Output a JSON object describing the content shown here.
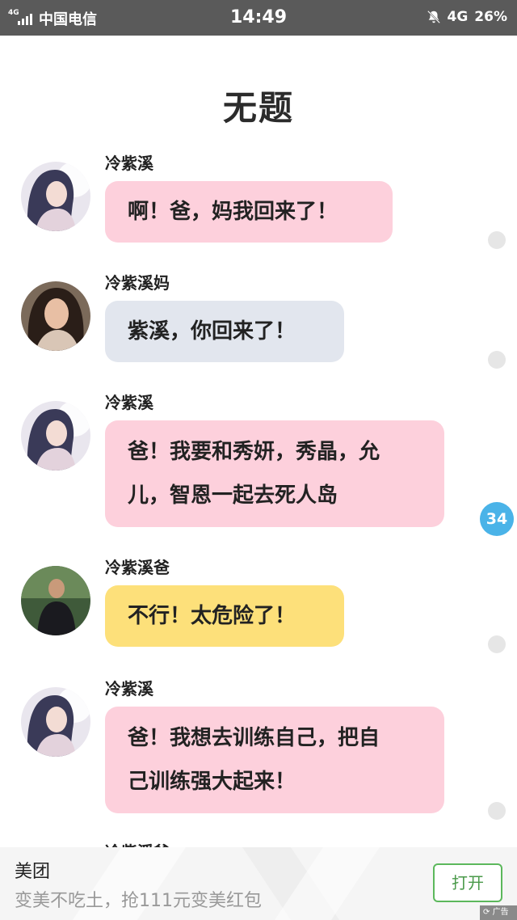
{
  "status_bar": {
    "network": "4G",
    "carrier": "中国电信",
    "time": "14:49",
    "network_right": "4G",
    "battery": "26%"
  },
  "title": "无题",
  "messages": [
    {
      "name": "冷紫溪",
      "text": "啊！爸，妈我回来了！",
      "color": "#fdd0dc"
    },
    {
      "name": "冷紫溪妈",
      "text": "紫溪，你回来了！",
      "color": "#e2e6ee"
    },
    {
      "name": "冷紫溪",
      "line1": "爸！我要和秀妍，秀晶，允",
      "line2": "儿，智恩一起去死人岛",
      "color": "#fdd0dc"
    },
    {
      "name": "冷紫溪爸",
      "text": "不行！太危险了！",
      "color": "#fde07a"
    },
    {
      "name": "冷紫溪",
      "line1": "爸！我想去训练自己，把自",
      "line2": "己训练强大起来！",
      "color": "#fdd0dc"
    },
    {
      "name": "冷紫溪爸"
    }
  ],
  "comment_badge": "34",
  "ad": {
    "name": "美团",
    "description": "变美不吃土，抢111元变美红包",
    "button": "打开",
    "tag": "广告"
  }
}
